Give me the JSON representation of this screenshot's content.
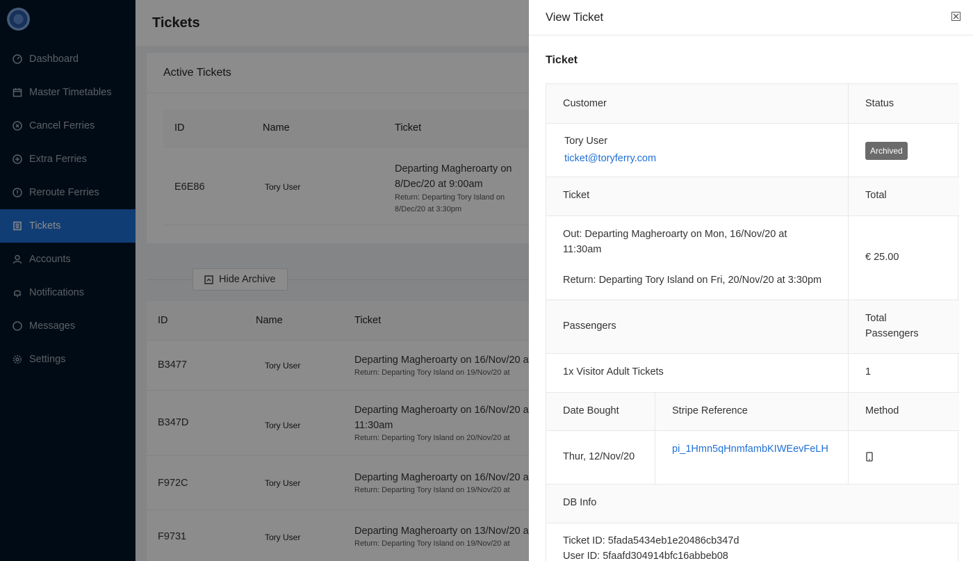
{
  "sidebar": {
    "items": [
      {
        "label": "Dashboard",
        "icon": "dashboard-icon"
      },
      {
        "label": "Master Timetables",
        "icon": "calendar-icon"
      },
      {
        "label": "Cancel Ferries",
        "icon": "close-circle-icon"
      },
      {
        "label": "Extra Ferries",
        "icon": "plus-circle-icon"
      },
      {
        "label": "Reroute Ferries",
        "icon": "exclamation-circle-icon"
      },
      {
        "label": "Tickets",
        "icon": "ticket-icon",
        "active": true
      },
      {
        "label": "Accounts",
        "icon": "user-icon"
      },
      {
        "label": "Notifications",
        "icon": "bell-icon"
      },
      {
        "label": "Messages",
        "icon": "message-icon"
      },
      {
        "label": "Settings",
        "icon": "gear-icon"
      }
    ]
  },
  "main": {
    "page_title": "Tickets",
    "active_card_title": "Active Tickets",
    "columns": {
      "id": "ID",
      "name": "Name",
      "ticket": "Ticket"
    },
    "active_row": {
      "id": "E6E86",
      "name": "Tory User",
      "ticket_line1": "Departing Magheroarty on",
      "ticket_line2": "8/Dec/20 at 9:00am",
      "return_line1": "Return: Departing Tory Island on",
      "return_line2": "8/Dec/20 at 3:30pm"
    },
    "archive_button": "Hide Archive",
    "archive_rows": [
      {
        "id": "B3477",
        "name": "Tory User",
        "ticket": "Departing Magheroarty on 16/Nov/20 a",
        "ticket2": "",
        "return": "Return: Departing Tory Island on 19/Nov/20 at"
      },
      {
        "id": "B347D",
        "name": "Tory User",
        "ticket": "Departing Magheroarty on 16/Nov/20 a",
        "ticket2": "11:30am",
        "return": "Return: Departing Tory Island on 20/Nov/20 at"
      },
      {
        "id": "F972C",
        "name": "Tory User",
        "ticket": "Departing Magheroarty on 16/Nov/20 a",
        "ticket2": "",
        "return": "Return: Departing Tory Island on 19/Nov/20 at"
      },
      {
        "id": "F9731",
        "name": "Tory User",
        "ticket": "Departing Magheroarty on 13/Nov/20 a",
        "ticket2": "",
        "return": "Return: Departing Tory Island on 19/Nov/20 at"
      }
    ]
  },
  "drawer": {
    "title": "View Ticket",
    "section_title": "Ticket",
    "customer_label": "Customer",
    "status_label": "Status",
    "customer_name": "Tory User",
    "customer_email": "ticket@toryferry.com",
    "status": "Archived",
    "ticket_label": "Ticket",
    "total_label": "Total",
    "out_line1": "Out: Departing Magheroarty on Mon, 16/Nov/20 at",
    "out_line2": "11:30am",
    "return_line": "Return: Departing Tory Island on Fri, 20/Nov/20 at 3:30pm",
    "total": "€ 25.00",
    "passengers_label": "Passengers",
    "total_passengers_label1": "Total",
    "total_passengers_label2": "Passengers",
    "passengers_value": "1x Visitor Adult Tickets",
    "total_passengers": "1",
    "date_bought_label": "Date Bought",
    "stripe_label": "Stripe Reference",
    "method_label": "Method",
    "date_bought": "Thur, 12/Nov/20",
    "stripe_ref": "pi_1Hmn5qHnmfambKIWEevFeLH",
    "method_icon": "mobile-phone-icon",
    "db_info_label": "DB Info",
    "ticket_id": "Ticket ID: 5fada5434eb1e20486cb347d",
    "user_id": "User ID: 5faafd304914bfc16abbeb08"
  }
}
